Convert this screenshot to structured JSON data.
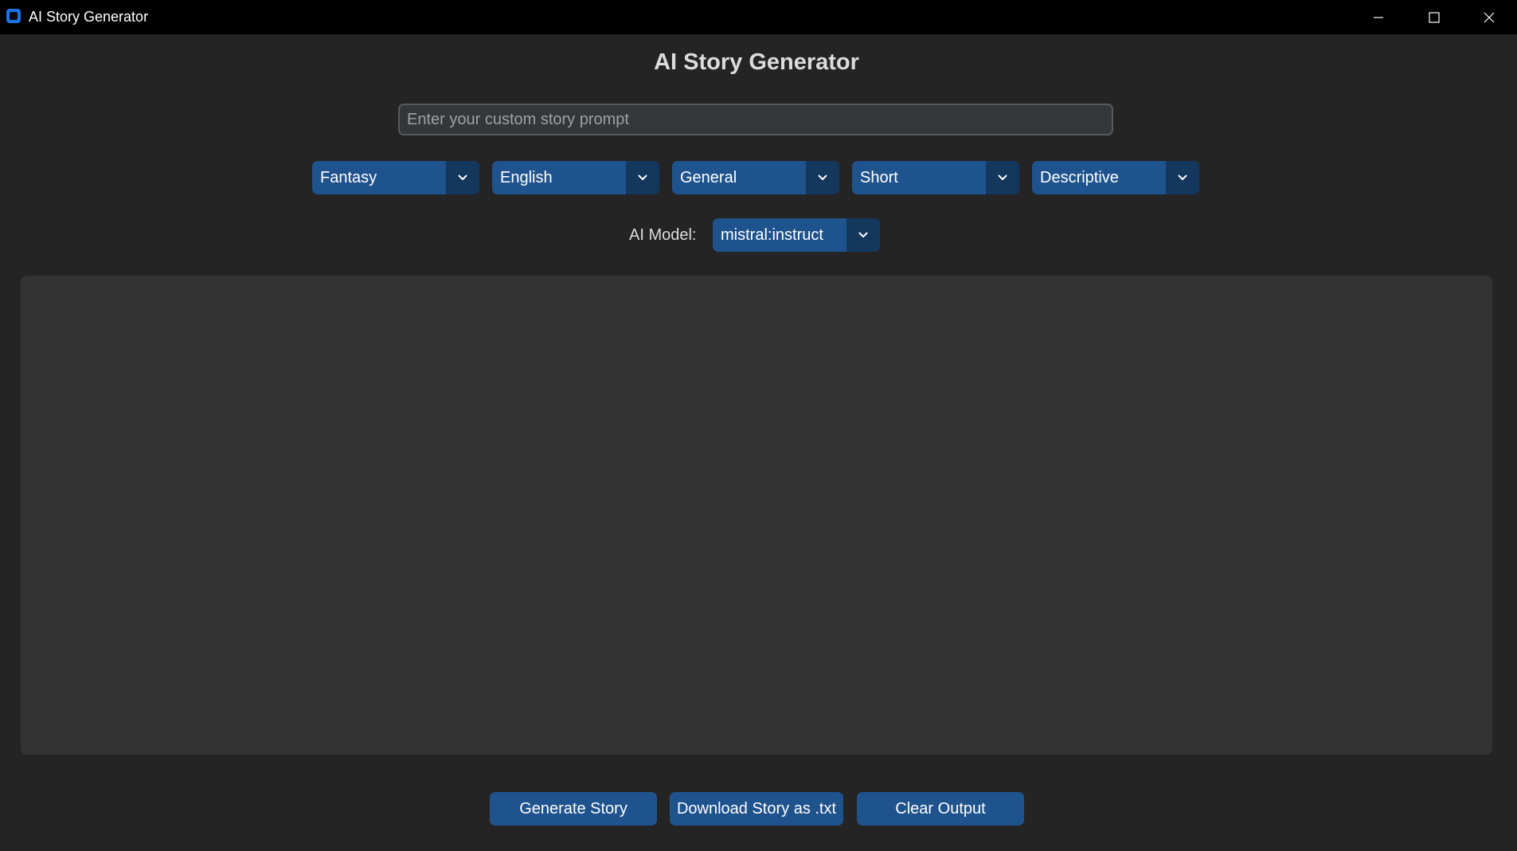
{
  "window": {
    "title": "AI Story Generator"
  },
  "header": {
    "title": "AI Story Generator"
  },
  "prompt": {
    "value": "",
    "placeholder": "Enter your custom story prompt"
  },
  "options": {
    "genre": "Fantasy",
    "language": "English",
    "audience": "General",
    "length": "Short",
    "style": "Descriptive"
  },
  "model": {
    "label": "AI Model:",
    "selected": "mistral:instruct"
  },
  "output": {
    "text": ""
  },
  "actions": {
    "generate_label": "Generate Story",
    "download_label": "Download Story as .txt",
    "clear_label": "Clear Output"
  },
  "icons": {
    "app": "app-icon",
    "minimize": "minimize-icon",
    "maximize": "maximize-icon",
    "close": "close-icon",
    "dropdown": "chevron-down-icon"
  },
  "colors": {
    "accent": "#1f538d",
    "accent_dark": "#14375e",
    "background": "#242424",
    "panel": "#333333",
    "titlebar": "#000000"
  }
}
